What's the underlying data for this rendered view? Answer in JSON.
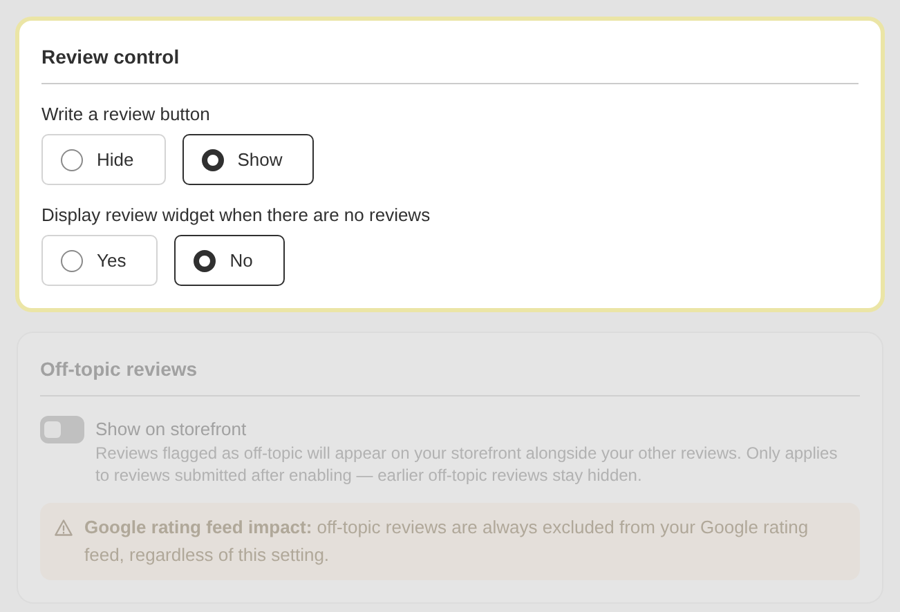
{
  "sections": [
    {
      "kind": "choices",
      "title": "Review control",
      "highlighted": true,
      "dimmed": false,
      "groups": [
        {
          "label": "Write a review button",
          "options": [
            {
              "label": "Hide",
              "selected": false
            },
            {
              "label": "Show",
              "selected": true
            }
          ]
        },
        {
          "label": "Display review widget when there are no reviews",
          "options": [
            {
              "label": "Yes",
              "selected": false
            },
            {
              "label": "No",
              "selected": true
            }
          ]
        }
      ]
    },
    {
      "kind": "toggle",
      "title": "Off-topic reviews",
      "highlighted": false,
      "dimmed": true,
      "toggle": {
        "label": "Show on storefront",
        "on": false,
        "description": "Reviews flagged as off-topic will appear on your storefront alongside your other reviews. Only applies to reviews submitted after enabling — earlier off-topic reviews stay hidden."
      },
      "notice": {
        "text": "**Google rating feed impact:** off-topic reviews are always excluded from your Google rating feed, regardless of this setting."
      }
    }
  ]
}
